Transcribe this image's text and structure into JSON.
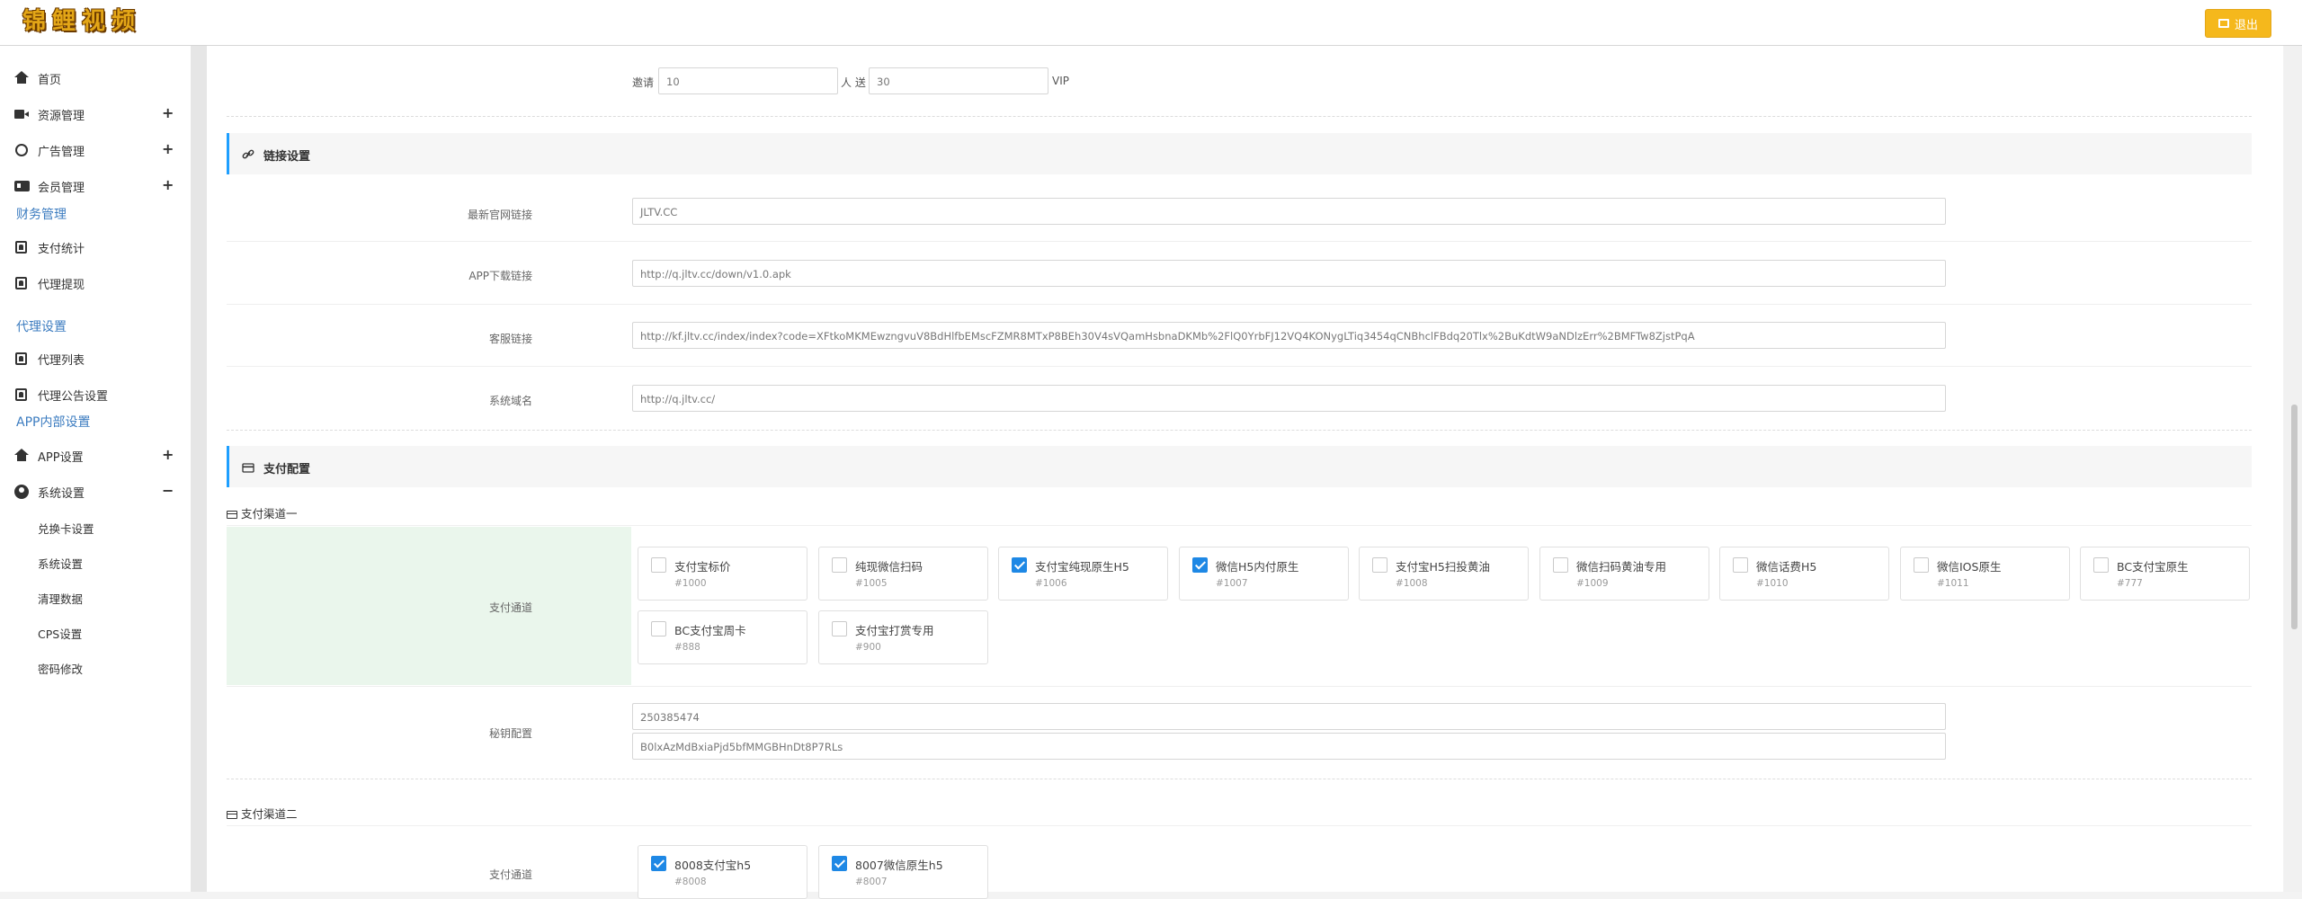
{
  "header": {
    "logo_chars": [
      "锦",
      "鲤",
      "视",
      "频"
    ],
    "logout_label": "退出"
  },
  "sidebar": {
    "items": [
      {
        "label": "首页",
        "icon": "home-icon"
      },
      {
        "label": "资源管理",
        "icon": "video-camera-icon",
        "expand": "+"
      },
      {
        "label": "广告管理",
        "icon": "globe-icon",
        "expand": "+"
      },
      {
        "label": "会员管理",
        "icon": "id-card-icon",
        "expand": "+"
      }
    ],
    "finance": {
      "title": "财务管理",
      "items": [
        "支付统计",
        "代理提现"
      ]
    },
    "agent": {
      "title": "代理设置",
      "items": [
        "代理列表",
        "代理公告设置"
      ]
    },
    "app_internal": {
      "title": "APP内部设置",
      "app_settings": {
        "label": "APP设置",
        "expand": "+"
      },
      "system_settings": {
        "label": "系统设置",
        "expand": "−"
      }
    },
    "system_sub_items": [
      "兑换卡设置",
      "系统设置",
      "清理数据",
      "CPS设置",
      "密码修改"
    ]
  },
  "invite": {
    "prefix": "邀请",
    "count_value": "10",
    "middle": "人 送",
    "reward_value": "30",
    "suffix": "VIP"
  },
  "link_section": {
    "title": "链接设置",
    "rows": [
      {
        "label": "最新官网链接",
        "value": "JLTV.CC"
      },
      {
        "label": "APP下载链接",
        "value": "http://q.jltv.cc/down/v1.0.apk"
      },
      {
        "label": "客服链接",
        "value": "http://kf.jltv.cc/index/index?code=XFtkoMKMEwzngvuV8BdHlfbEMscFZMR8MTxP8BEh30V4sVQamHsbnaDKMb%2FlQ0YrbFJ12VQ4KONygLTiq3454qCNBhclFBdq20Tlx%2BuKdtW9aNDlzErr%2BMFTw8ZjstPqA"
      },
      {
        "label": "系统域名",
        "value": "http://q.jltv.cc/"
      }
    ]
  },
  "payment_section": {
    "title": "支付配置",
    "channel1": {
      "title": "支付渠道一",
      "channel_label": "支付通道",
      "options": [
        {
          "name": "支付宝标价",
          "code": "#1000",
          "checked": false
        },
        {
          "name": "纯现微信扫码",
          "code": "#1005",
          "checked": false
        },
        {
          "name": "支付宝纯现原生H5",
          "code": "#1006",
          "checked": true
        },
        {
          "name": "微信H5内付原生",
          "code": "#1007",
          "checked": true
        },
        {
          "name": "支付宝H5扫投黄油",
          "code": "#1008",
          "checked": false
        },
        {
          "name": "微信扫码黄油专用",
          "code": "#1009",
          "checked": false
        },
        {
          "name": "微信话费H5",
          "code": "#1010",
          "checked": false
        },
        {
          "name": "微信IOS原生",
          "code": "#1011",
          "checked": false
        },
        {
          "name": "BC支付宝原生",
          "code": "#777",
          "checked": false
        },
        {
          "name": "BC支付宝周卡",
          "code": "#888",
          "checked": false
        },
        {
          "name": "支付宝打赏专用",
          "code": "#900",
          "checked": false
        }
      ],
      "key_label": "秘钥配置",
      "key_id": "250385474",
      "key_secret": "B0lxAzMdBxiaPjd5bfMMGBHnDt8P7RLs"
    },
    "channel2": {
      "title": "支付渠道二",
      "channel_label": "支付通道",
      "options": [
        {
          "name": "8008支付宝h5",
          "code": "#8008",
          "checked": true
        },
        {
          "name": "8007微信原生h5",
          "code": "#8007",
          "checked": true
        }
      ]
    }
  }
}
